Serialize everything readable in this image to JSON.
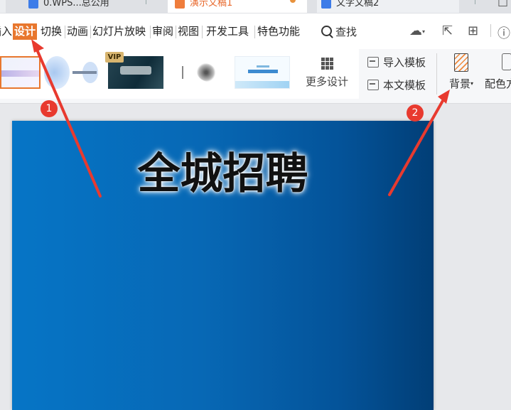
{
  "tabs": [
    {
      "label": "0.WPS...总公用"
    },
    {
      "label": "演示文稿1"
    },
    {
      "label": "文字文稿2"
    }
  ],
  "menu": {
    "items": [
      "插入",
      "设计",
      "切换",
      "动画",
      "幻灯片放映",
      "审阅",
      "视图",
      "开发工具",
      "特色功能"
    ],
    "active": "设计",
    "find_label": "查找"
  },
  "ribbon": {
    "vip_badge": "VIP",
    "more_design": "更多设计",
    "import_template": "导入模板",
    "this_template": "本文模板",
    "background": "背景",
    "color_scheme": "配色方案"
  },
  "slide": {
    "title": "全城招聘",
    "colors": {
      "start": "#0675c6",
      "end": "#013e76"
    }
  },
  "annotations": [
    {
      "number": "1",
      "color": "#e83a2f"
    },
    {
      "number": "2",
      "color": "#e83a2f"
    }
  ],
  "colors": {
    "accent": "#e8772e",
    "annotation": "#e83a2f"
  }
}
